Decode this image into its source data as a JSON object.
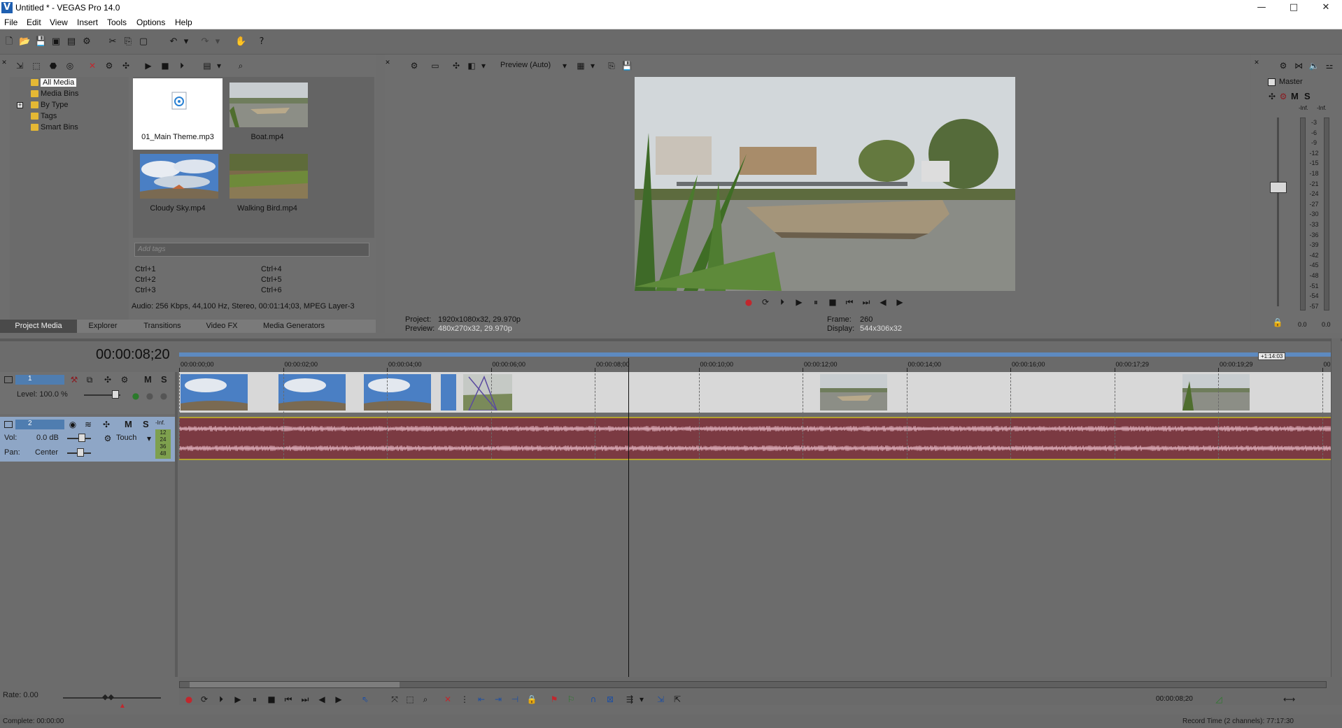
{
  "window": {
    "title": "Untitled * - VEGAS Pro 14.0",
    "controls": {
      "minimize": "—",
      "maximize": "□",
      "close": "✕"
    }
  },
  "menu": [
    "File",
    "Edit",
    "View",
    "Insert",
    "Tools",
    "Options",
    "Help"
  ],
  "media": {
    "tree": [
      "All Media",
      "Media Bins",
      "By Type",
      "Tags",
      "Smart Bins"
    ],
    "expander": "+",
    "files": [
      {
        "name": "01_Main Theme.mp3",
        "icon": "audio-file-icon"
      },
      {
        "name": "Boat.mp4",
        "icon": "boat-thumbnail"
      },
      {
        "name": "Cloudy Sky.mp4",
        "icon": "sky-thumbnail"
      },
      {
        "name": "Walking Bird.mp4",
        "icon": "grass-thumbnail"
      }
    ],
    "tags_placeholder": "Add tags",
    "shortcuts": [
      "Ctrl+1",
      "Ctrl+2",
      "Ctrl+3",
      "Ctrl+4",
      "Ctrl+5",
      "Ctrl+6"
    ],
    "info": "Audio: 256 Kbps, 44,100 Hz, Stereo, 00:01:14;03, MPEG Layer-3"
  },
  "tabs": [
    "Project Media",
    "Explorer",
    "Transitions",
    "Video FX",
    "Media Generators"
  ],
  "preview": {
    "mode": "Preview (Auto)",
    "project_label": "Project:",
    "project_value": "1920x1080x32, 29.970p",
    "preview_label": "Preview:",
    "preview_value": "480x270x32, 29.970p",
    "frame_label": "Frame:",
    "frame_value": "260",
    "display_label": "Display:",
    "display_value": "544x306x32"
  },
  "master": {
    "label": "Master",
    "m": "M",
    "s": "S",
    "inf_left": "-Inf.",
    "inf_right": "-Inf.",
    "scale": [
      "3",
      "6",
      "9",
      "12",
      "15",
      "18",
      "21",
      "24",
      "27",
      "30",
      "33",
      "36",
      "39",
      "42",
      "45",
      "48",
      "51",
      "54",
      "57"
    ],
    "value_left": "0.0",
    "value_right": "0.0"
  },
  "timeline": {
    "timecode": "00:00:08;20",
    "end_marker": "+1:14:03",
    "ruler": [
      "00:00:00;00",
      "00:00:02;00",
      "00:00:04;00",
      "00:00:06;00",
      "00:00:08;00",
      "00:00:10;00",
      "00:00:12;00",
      "00:00:14;00",
      "00:00:16;00",
      "00:00:17;29",
      "00:00:19;29",
      "00"
    ],
    "track1": {
      "number": "1",
      "level_label": "Level: 100.0 %",
      "m": "M",
      "s": "S"
    },
    "track2": {
      "number": "2",
      "vol_label": "Vol:",
      "vol_value": "0.0 dB",
      "pan_label": "Pan:",
      "pan_value": "Center",
      "automation": "Touch",
      "m": "M",
      "s": "S",
      "inf": "-Inf.",
      "meter": [
        "12",
        "24",
        "36",
        "48"
      ]
    }
  },
  "status": {
    "rate": "Rate: 0.00",
    "complete": "Complete: 00:00:00",
    "cursor_time": "00:00:08;20",
    "record_time": "Record Time (2 channels): 77:17:30"
  },
  "colors": {
    "accent": "#1f5fb0",
    "audio_track": "#7b3a42",
    "audio_wave": "#d8a8b4",
    "track_header": "#4f7db0",
    "folder": "#e5b834"
  }
}
